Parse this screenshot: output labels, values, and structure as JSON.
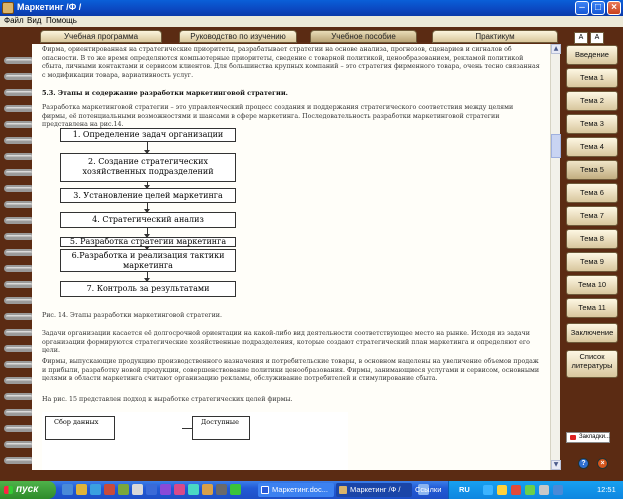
{
  "window": {
    "title": "Маркетинг /Ф /"
  },
  "menu": [
    "Файл",
    "Вид",
    "Помощь"
  ],
  "top_tabs": [
    {
      "label": "Учебная программа"
    },
    {
      "label": "Руководство по изучению"
    },
    {
      "label": "Учебное пособие",
      "active": true
    },
    {
      "label": "Практикум"
    }
  ],
  "font_buttons": [
    "A",
    "A"
  ],
  "nav": [
    "Введение",
    "Тема 1",
    "Тема 2",
    "Тема 3",
    "Тема 4",
    "Тема 5",
    "Тема 6",
    "Тема 7",
    "Тема 8",
    "Тема 9",
    "Тема 10",
    "Тема 11",
    "Заключение",
    "Список литературы"
  ],
  "nav_active_index": 5,
  "content": {
    "para1": "Фирма, ориентированная на стратегические приоритеты, разрабатывает стратегии на основе анализа, прогнозов, сценариев и сигналов об опасности. В то же время определяются компьютерные приоритеты, сведение с товарной политикой, ценообразованием, рекламой политикой сбыта, личными контактами и сервисом клиентов. Для большинства крупных компаний – это стратегия фирменного товара, очень тесно связанная с модификации товара, вариативность услуг.",
    "heading": "5.3. Этапы и содержание разработки маркетинговой стратегии.",
    "para2": "Разработка маркетинговой стратегии – это управленческий процесс создания и поддержания стратегического соответствия между целями фирмы, её потенциальными возможностями и шансами в сфере маркетинга. Последовательность разработки маркетинговой стратегии представлена на рис.14.",
    "flow_steps": [
      "1. Определение задач организации",
      "2. Создание стратегических хозяйственных подразделений",
      "3. Установление целей маркетинга",
      "4. Стратегический анализ",
      "5. Разработка стратегии маркетинга",
      "6.Разработка и реализация тактики маркетинга",
      "7. Контроль за результатами"
    ],
    "caption": "Рис. 14. Этапы разработки маркетинговой стратегии.",
    "para3": "Задачи организации касается её долгосрочной ориентации на какой-либо вид деятельности соответствующее место на рынке. Исходя из задачи организации формируются стратегические хозяйственные подразделения, которые создают стратегический план маркетинга и определяют его цели.",
    "para4": "Фирмы, выпускающие продукцию производственного назначения и потребительские товары, в основном нацелены на увеличение объемов продаж и прибыли, разработку новой продукции, совершенствование политики ценообразования. Фирмы, занимающиеся услугами и сервисом, основными целями в области маркетинга считают организацию рекламы, обслуживание потребителей и стимулирование сбыта.",
    "para5": "На рис. 15 представлен подход к выработке стратегических целей фирмы.",
    "fig2_box1": "Сбор данных",
    "fig2_box2": "Доступные"
  },
  "bookmark_label": "Закладки...",
  "round_buttons": [
    "?",
    "×"
  ],
  "taskbar": {
    "start": "пуск",
    "items": [
      "Маркетинг.doc...",
      "Маркетинг /Ф /"
    ],
    "tray_text": "Ссылки",
    "lang": "RU",
    "time": "12:51"
  }
}
